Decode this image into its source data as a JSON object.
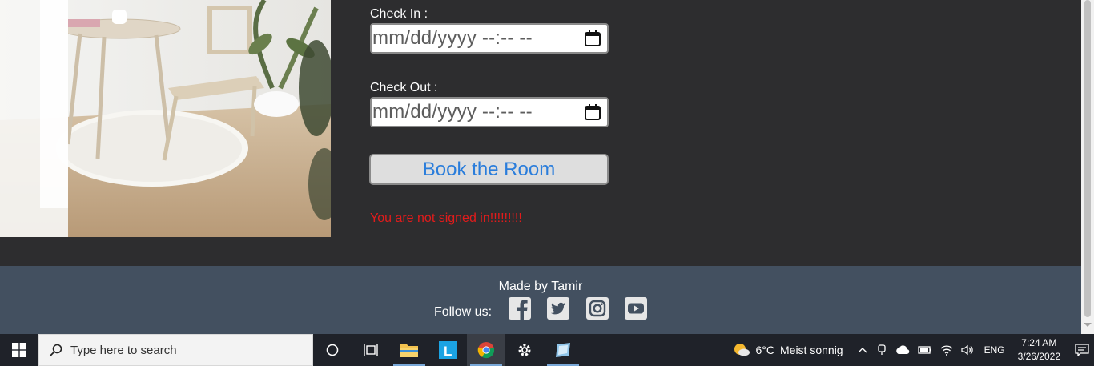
{
  "form": {
    "check_in_label": "Check In :",
    "check_in_placeholder": "mm/dd/yyyy --:-- --",
    "check_out_label": "Check Out :",
    "check_out_placeholder": "mm/dd/yyyy --:-- --",
    "book_button": "Book the Room",
    "error_message": "You are not signed in!!!!!!!!!"
  },
  "footer": {
    "made_by": "Made by Tamir",
    "follow_us": "Follow us:",
    "social_icons": [
      "facebook-icon",
      "twitter-icon",
      "instagram-icon",
      "youtube-icon"
    ]
  },
  "taskbar": {
    "search_placeholder": "Type here to search",
    "weather_temp": "6°C",
    "weather_desc": "Meist sonnig",
    "language": "ENG",
    "time": "7:24 AM",
    "date": "3/26/2022"
  },
  "colors": {
    "background": "#2d2d2f",
    "footer": "#435060",
    "button_text": "#2a7ddb",
    "error": "#e21b1b"
  }
}
